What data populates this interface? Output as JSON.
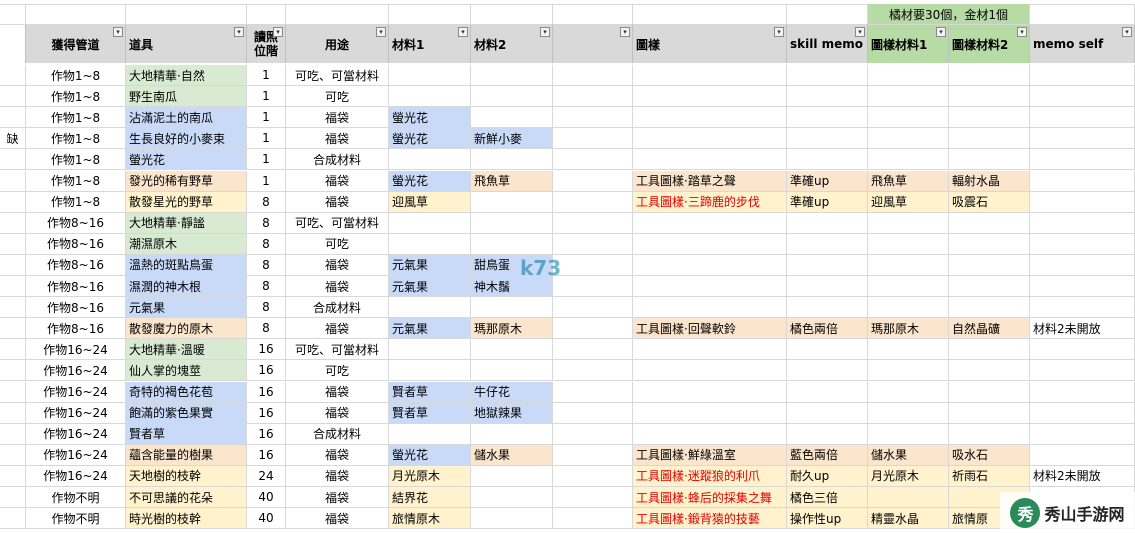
{
  "top_note": "橘材要30個，金材1個",
  "headers": [
    "獲得管道",
    "道具",
    "讀照位階",
    "用途",
    "材料1",
    "材料2",
    "",
    "圖樣",
    "skill memo",
    "圖樣材料1",
    "圖樣材料2",
    "memo self"
  ],
  "rows": [
    {
      "mark": "",
      "src": "作物1~8",
      "item": "大地精華·自然",
      "lv": "1",
      "use": "可吃、可當材料",
      "m1": "",
      "m2": "",
      "pat": "",
      "skill": "",
      "pm1": "",
      "pm2": "",
      "memo": ""
    },
    {
      "mark": "",
      "src": "作物1~8",
      "item": "野生南瓜",
      "lv": "1",
      "use": "可吃",
      "m1": "",
      "m2": "",
      "pat": "",
      "skill": "",
      "pm1": "",
      "pm2": "",
      "memo": ""
    },
    {
      "mark": "",
      "src": "作物1~8",
      "item": "沾滿泥土的南瓜",
      "lv": "1",
      "use": "福袋",
      "m1": "螢光花",
      "m2": "",
      "pat": "",
      "skill": "",
      "pm1": "",
      "pm2": "",
      "memo": ""
    },
    {
      "mark": "缺",
      "src": "作物1~8",
      "item": "生長良好的小麥束",
      "lv": "1",
      "use": "福袋",
      "m1": "螢光花",
      "m2": "新鮮小麥",
      "pat": "",
      "skill": "",
      "pm1": "",
      "pm2": "",
      "memo": ""
    },
    {
      "mark": "",
      "src": "作物1~8",
      "item": "螢光花",
      "lv": "1",
      "use": "合成材料",
      "m1": "",
      "m2": "",
      "pat": "",
      "skill": "",
      "pm1": "",
      "pm2": "",
      "memo": ""
    },
    {
      "mark": "",
      "src": "作物1~8",
      "item": "發光的稀有野草",
      "lv": "1",
      "use": "福袋",
      "m1": "螢光花",
      "m2": "飛魚草",
      "pat": "工具圖樣·踏草之聲",
      "skill": "準確up",
      "pm1": "飛魚草",
      "pm2": "輻射水晶",
      "memo": ""
    },
    {
      "mark": "",
      "src": "作物1~8",
      "item": "散發星光的野草",
      "lv": "8",
      "use": "福袋",
      "m1": "迎風草",
      "m2": "",
      "pat": "工具圖樣·三蹄鹿的步伐",
      "skill": "準確up",
      "pm1": "迎風草",
      "pm2": "吸震石",
      "memo": ""
    },
    {
      "mark": "",
      "src": "作物8~16",
      "item": "大地精華·靜謐",
      "lv": "8",
      "use": "可吃、可當材料",
      "m1": "",
      "m2": "",
      "pat": "",
      "skill": "",
      "pm1": "",
      "pm2": "",
      "memo": ""
    },
    {
      "mark": "",
      "src": "作物8~16",
      "item": "潮濕原木",
      "lv": "8",
      "use": "可吃",
      "m1": "",
      "m2": "",
      "pat": "",
      "skill": "",
      "pm1": "",
      "pm2": "",
      "memo": ""
    },
    {
      "mark": "",
      "src": "作物8~16",
      "item": "溫熱的斑點鳥蛋",
      "lv": "8",
      "use": "福袋",
      "m1": "元氣果",
      "m2": "甜鳥蛋",
      "pat": "",
      "skill": "",
      "pm1": "",
      "pm2": "",
      "memo": ""
    },
    {
      "mark": "",
      "src": "作物8~16",
      "item": "濕潤的神木根",
      "lv": "8",
      "use": "福袋",
      "m1": "元氣果",
      "m2": "神木鬚",
      "pat": "",
      "skill": "",
      "pm1": "",
      "pm2": "",
      "memo": ""
    },
    {
      "mark": "",
      "src": "作物8~16",
      "item": "元氣果",
      "lv": "8",
      "use": "合成材料",
      "m1": "",
      "m2": "",
      "pat": "",
      "skill": "",
      "pm1": "",
      "pm2": "",
      "memo": ""
    },
    {
      "mark": "",
      "src": "作物8~16",
      "item": "散發魔力的原木",
      "lv": "8",
      "use": "福袋",
      "m1": "元氣果",
      "m2": "瑪那原木",
      "pat": "工具圖樣·回聲軟鈴",
      "skill": "橘色兩倍",
      "pm1": "瑪那原木",
      "pm2": "自然晶礦",
      "memo": "材料2未開放"
    },
    {
      "mark": "",
      "src": "作物16~24",
      "item": "大地精華·溫暖",
      "lv": "16",
      "use": "可吃、可當材料",
      "m1": "",
      "m2": "",
      "pat": "",
      "skill": "",
      "pm1": "",
      "pm2": "",
      "memo": ""
    },
    {
      "mark": "",
      "src": "作物16~24",
      "item": "仙人掌的塊莖",
      "lv": "16",
      "use": "可吃",
      "m1": "",
      "m2": "",
      "pat": "",
      "skill": "",
      "pm1": "",
      "pm2": "",
      "memo": ""
    },
    {
      "mark": "",
      "src": "作物16~24",
      "item": "奇特的褐色花苞",
      "lv": "16",
      "use": "福袋",
      "m1": "賢者草",
      "m2": "牛仔花",
      "pat": "",
      "skill": "",
      "pm1": "",
      "pm2": "",
      "memo": ""
    },
    {
      "mark": "",
      "src": "作物16~24",
      "item": "飽滿的紫色果實",
      "lv": "16",
      "use": "福袋",
      "m1": "賢者草",
      "m2": "地獄辣果",
      "pat": "",
      "skill": "",
      "pm1": "",
      "pm2": "",
      "memo": ""
    },
    {
      "mark": "",
      "src": "作物16~24",
      "item": "賢者草",
      "lv": "16",
      "use": "合成材料",
      "m1": "",
      "m2": "",
      "pat": "",
      "skill": "",
      "pm1": "",
      "pm2": "",
      "memo": ""
    },
    {
      "mark": "",
      "src": "作物16~24",
      "item": "蘊含能量的樹果",
      "lv": "16",
      "use": "福袋",
      "m1": "螢光花",
      "m2": "儲水果",
      "pat": "工具圖樣·鮮綠溫室",
      "skill": "藍色兩倍",
      "pm1": "儲水果",
      "pm2": "吸水石",
      "memo": ""
    },
    {
      "mark": "",
      "src": "作物16~24",
      "item": "天地樹的枝幹",
      "lv": "24",
      "use": "福袋",
      "m1": "月光原木",
      "m2": "",
      "pat": "工具圖樣·迷蹤狼的利爪",
      "skill": "耐久up",
      "pm1": "月光原木",
      "pm2": "祈雨石",
      "memo": "材料2未開放"
    },
    {
      "mark": "",
      "src": "作物不明",
      "item": "不可思議的花朵",
      "lv": "40",
      "use": "福袋",
      "m1": "結界花",
      "m2": "",
      "pat": "工具圖樣·蜂后的採集之舞",
      "skill": "橘色三倍",
      "pm1": "",
      "pm2": "",
      "memo": ""
    },
    {
      "mark": "",
      "src": "作物不明",
      "item": "時光樹的枝幹",
      "lv": "40",
      "use": "福袋",
      "m1": "旅情原木",
      "m2": "",
      "pat": "工具圖樣·鍛背猿的技藝",
      "skill": "操作性up",
      "pm1": "精靈水晶",
      "pm2": "旅情原",
      "memo": ""
    }
  ],
  "watermark": "k73",
  "logo": {
    "glyph": "秀",
    "text": "秀山手游网"
  }
}
